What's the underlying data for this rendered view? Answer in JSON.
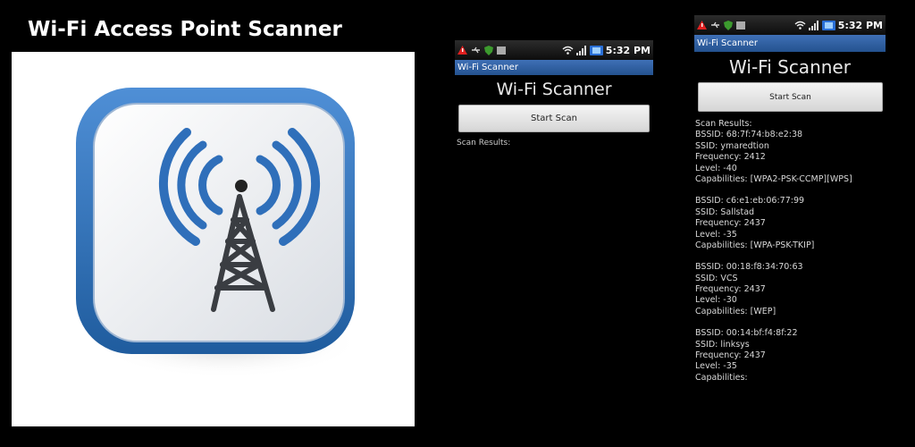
{
  "banner": {
    "title": "Wi-Fi Access Point Scanner"
  },
  "phone_small": {
    "status_time": "5:32 PM",
    "app_title": "Wi-Fi Scanner",
    "heading": "Wi-Fi Scanner",
    "scan_button": "Start Scan",
    "results_label": "Scan Results:"
  },
  "phone_large": {
    "status_time": "5:32 PM",
    "app_title": "Wi-Fi Scanner",
    "heading": "Wi-Fi Scanner",
    "scan_button": "Start Scan",
    "results_label": "Scan Results:",
    "networks": [
      {
        "bssid": "BSSID: 68:7f:74:b8:e2:38",
        "ssid": "SSID: ymaredtion",
        "frequency": "Frequency: 2412",
        "level": "Level: -40",
        "capabilities": "Capabilities: [WPA2-PSK-CCMP][WPS]"
      },
      {
        "bssid": "BSSID: c6:e1:eb:06:77:99",
        "ssid": "SSID: Sallstad",
        "frequency": "Frequency: 2437",
        "level": "Level: -35",
        "capabilities": "Capabilities: [WPA-PSK-TKIP]"
      },
      {
        "bssid": "BSSID: 00:18:f8:34:70:63",
        "ssid": "SSID: VCS",
        "frequency": "Frequency: 2437",
        "level": "Level: -30",
        "capabilities": "Capabilities: [WEP]"
      },
      {
        "bssid": "BSSID: 00:14:bf:f4:8f:22",
        "ssid": "SSID: linksys",
        "frequency": "Frequency: 2437",
        "level": "Level: -35",
        "capabilities": "Capabilities:"
      }
    ]
  },
  "icons": {
    "app_logo": "wifi-tower-icon",
    "status": [
      "warning-icon",
      "usb-icon",
      "shield-icon",
      "sd-card-icon",
      "wifi-signal-icon",
      "cell-signal-icon",
      "battery-icon"
    ]
  },
  "colors": {
    "app_bar": "#2f5fa0",
    "logo_blue": "#2f6fba"
  }
}
